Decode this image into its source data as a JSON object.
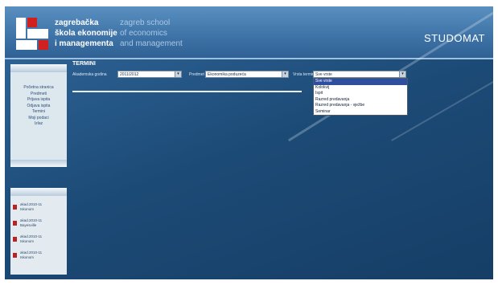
{
  "header": {
    "school_lines": [
      "zagrebačka",
      "škola ekonomije",
      "i managementa"
    ],
    "school_en_lines": [
      "zagreb school",
      "of economics",
      "and management"
    ],
    "app_title": "STUDOMAT"
  },
  "nav": {
    "items": [
      "Početna stranica",
      "Predmeti",
      "Prijava ispita",
      "Odjava ispita",
      "Termini",
      "Moji podaci",
      "Izlaz"
    ]
  },
  "docs": {
    "items": [
      {
        "line1": "akad.2010-11",
        "line2": "Iskonom"
      },
      {
        "line1": "akad.2010-11",
        "line2": "Bayesville"
      },
      {
        "line1": "akad.2010-11",
        "line2": "Iskonom"
      },
      {
        "line1": "akad.2010-11",
        "line2": "Iskonom"
      }
    ]
  },
  "termini": {
    "title": "TERMINI",
    "academic_year_label": "Akademska godina",
    "academic_year_value": "2011/2012",
    "subject_label": "Predmet",
    "subject_value": "Ekonomika poduzeća",
    "type_label": "Vrsta termina",
    "type_value": "Sve vrste",
    "type_options": [
      "Sve vrste",
      "Kolokvij",
      "Ispit",
      "Razred predavanja",
      "Razred predavanja - vježbe",
      "Seminar"
    ],
    "type_highlighted_index": 0
  }
}
